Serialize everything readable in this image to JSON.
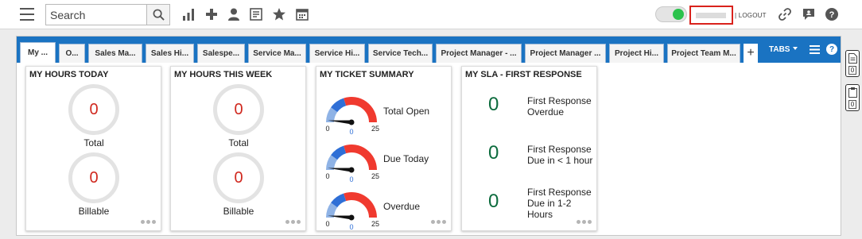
{
  "search": {
    "placeholder": "Search"
  },
  "toolbar": {
    "icons": [
      "hamburger-icon",
      "search-icon",
      "bar-chart-icon",
      "plus-icon",
      "person-icon",
      "form-icon",
      "star-icon",
      "calendar-icon",
      "link-icon",
      "chat-icon",
      "help-icon"
    ],
    "logout_label": "| LOGOUT"
  },
  "tabs": [
    {
      "label": "My ..."
    },
    {
      "label": "O..."
    },
    {
      "label": "Sales Ma..."
    },
    {
      "label": "Sales Hi..."
    },
    {
      "label": "Salespe..."
    },
    {
      "label": "Service Ma..."
    },
    {
      "label": "Service Hi..."
    },
    {
      "label": "Service Tech..."
    },
    {
      "label": "Project Manager - ..."
    },
    {
      "label": "Project Manager ..."
    },
    {
      "label": "Project Hi..."
    },
    {
      "label": "Project Team M..."
    }
  ],
  "tab_add_label": "+",
  "tabs_menu_label": "TABS",
  "tab_help_label": "?",
  "widgets": {
    "hours_today": {
      "title": "MY HOURS TODAY",
      "total": {
        "value": "0",
        "label": "Total"
      },
      "billable": {
        "value": "0",
        "label": "Billable"
      }
    },
    "hours_week": {
      "title": "MY HOURS THIS WEEK",
      "total": {
        "value": "0",
        "label": "Total"
      },
      "billable": {
        "value": "0",
        "label": "Billable"
      }
    },
    "ticket_summary": {
      "title": "MY TICKET SUMMARY",
      "gauges": [
        {
          "label": "Total Open",
          "value": "0",
          "min": "0",
          "max": "25",
          "current": 0
        },
        {
          "label": "Due Today",
          "value": "0",
          "min": "0",
          "max": "25",
          "current": 0
        },
        {
          "label": "Overdue",
          "value": "0",
          "min": "0",
          "max": "25",
          "current": 0
        }
      ]
    },
    "sla": {
      "title": "MY SLA - FIRST RESPONSE",
      "rows": [
        {
          "value": "0",
          "label_line1": "First Response",
          "label_line2": "Overdue",
          "label_line3": ""
        },
        {
          "value": "0",
          "label_line1": "First Response",
          "label_line2": "Due in < 1 hour",
          "label_line3": ""
        },
        {
          "value": "0",
          "label_line1": "First Response",
          "label_line2": "Due in 1-2",
          "label_line3": "Hours"
        }
      ]
    }
  },
  "side_badges": [
    {
      "icon": "document-icon",
      "count": "0"
    },
    {
      "icon": "clipboard-icon",
      "count": "0"
    }
  ],
  "colors": {
    "tab_bar": "#1a73c2",
    "ring_value": "#d0281e",
    "sla_value": "#0c6b3d",
    "toggle_on": "#2bc24c",
    "highlight_box": "#d9221c"
  }
}
